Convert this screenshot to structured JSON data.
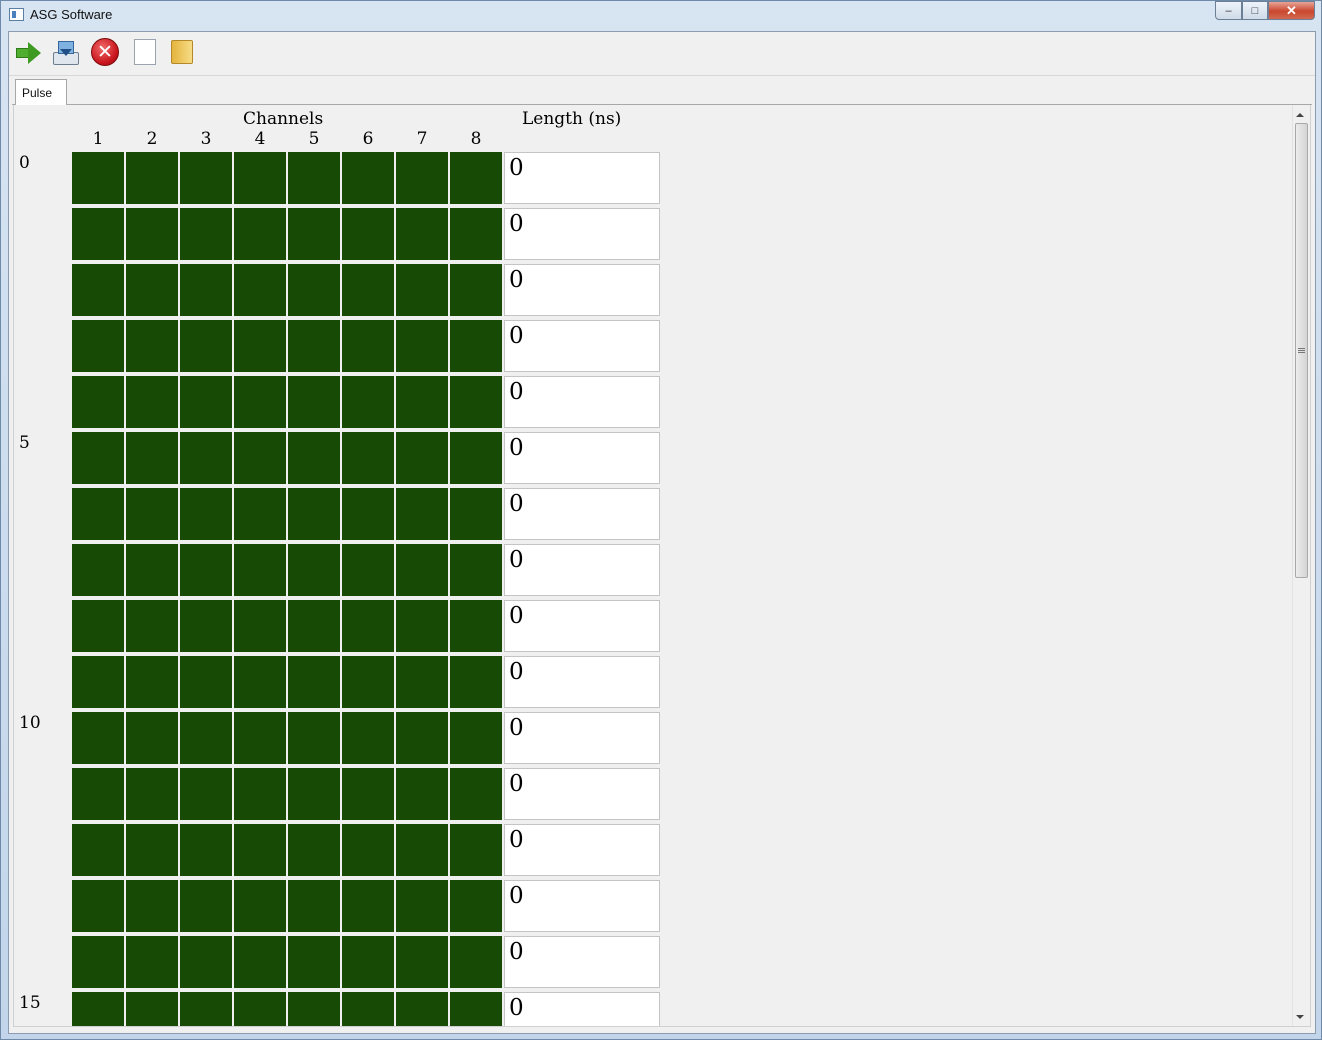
{
  "window": {
    "title": "ASG Software",
    "controls": {
      "minimize": "–",
      "maximize": "□",
      "close": "✕"
    }
  },
  "toolbar": {
    "buttons": [
      {
        "name": "start-icon",
        "tooltip": ""
      },
      {
        "name": "download-icon",
        "tooltip": ""
      },
      {
        "name": "stop-icon",
        "tooltip": ""
      },
      {
        "name": "new-file-icon",
        "tooltip": ""
      },
      {
        "name": "open-folder-icon",
        "tooltip": ""
      }
    ],
    "stop_glyph": "✕"
  },
  "tabs": [
    {
      "label": "Pulse",
      "active": true
    }
  ],
  "grid": {
    "channels_title": "Channels",
    "length_title": "Length (ns)",
    "channel_numbers": [
      "1",
      "2",
      "3",
      "4",
      "5",
      "6",
      "7",
      "8"
    ],
    "row_labels": [
      {
        "row": 0,
        "label": "0"
      },
      {
        "row": 5,
        "label": "5"
      },
      {
        "row": 10,
        "label": "10"
      },
      {
        "row": 15,
        "label": "15"
      }
    ],
    "cell_color": "#174a04",
    "rows": [
      {
        "length": "0",
        "channels": [
          false,
          false,
          false,
          false,
          false,
          false,
          false,
          false
        ]
      },
      {
        "length": "0",
        "channels": [
          false,
          false,
          false,
          false,
          false,
          false,
          false,
          false
        ]
      },
      {
        "length": "0",
        "channels": [
          false,
          false,
          false,
          false,
          false,
          false,
          false,
          false
        ]
      },
      {
        "length": "0",
        "channels": [
          false,
          false,
          false,
          false,
          false,
          false,
          false,
          false
        ]
      },
      {
        "length": "0",
        "channels": [
          false,
          false,
          false,
          false,
          false,
          false,
          false,
          false
        ]
      },
      {
        "length": "0",
        "channels": [
          false,
          false,
          false,
          false,
          false,
          false,
          false,
          false
        ]
      },
      {
        "length": "0",
        "channels": [
          false,
          false,
          false,
          false,
          false,
          false,
          false,
          false
        ]
      },
      {
        "length": "0",
        "channels": [
          false,
          false,
          false,
          false,
          false,
          false,
          false,
          false
        ]
      },
      {
        "length": "0",
        "channels": [
          false,
          false,
          false,
          false,
          false,
          false,
          false,
          false
        ]
      },
      {
        "length": "0",
        "channels": [
          false,
          false,
          false,
          false,
          false,
          false,
          false,
          false
        ]
      },
      {
        "length": "0",
        "channels": [
          false,
          false,
          false,
          false,
          false,
          false,
          false,
          false
        ]
      },
      {
        "length": "0",
        "channels": [
          false,
          false,
          false,
          false,
          false,
          false,
          false,
          false
        ]
      },
      {
        "length": "0",
        "channels": [
          false,
          false,
          false,
          false,
          false,
          false,
          false,
          false
        ]
      },
      {
        "length": "0",
        "channels": [
          false,
          false,
          false,
          false,
          false,
          false,
          false,
          false
        ]
      },
      {
        "length": "0",
        "channels": [
          false,
          false,
          false,
          false,
          false,
          false,
          false,
          false
        ]
      },
      {
        "length": "0",
        "channels": [
          false,
          false,
          false,
          false,
          false,
          false,
          false,
          false
        ]
      }
    ]
  }
}
